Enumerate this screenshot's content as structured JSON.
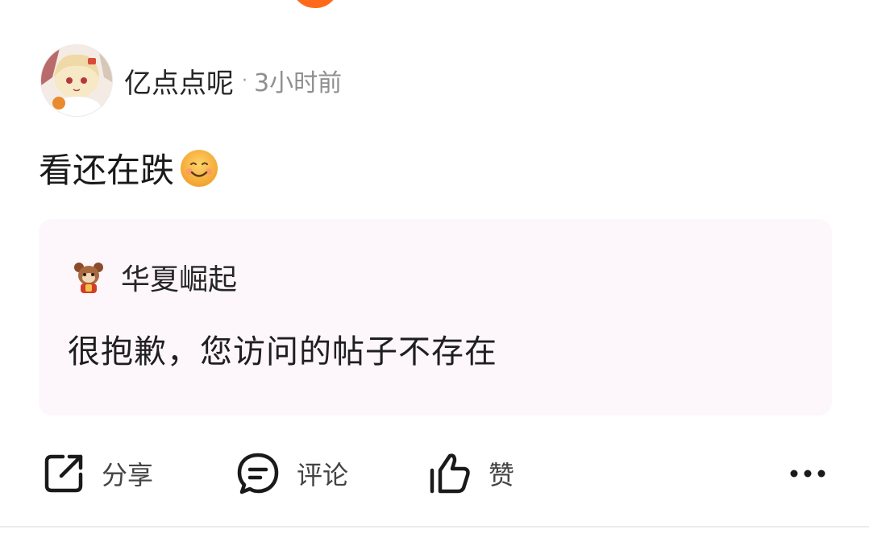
{
  "post": {
    "author": "亿点点呢",
    "separator": "·",
    "time": "3小时前",
    "text": "看还在跌",
    "emoji": "smile-emoji"
  },
  "quote": {
    "author": "华夏崛起",
    "text": "很抱歉，您访问的帖子不存在"
  },
  "actions": {
    "share_label": "分享",
    "comment_label": "评论",
    "like_label": "赞",
    "more_icon": "more-dots-icon"
  },
  "colors": {
    "accent": "#ff6a1a",
    "quote_bg": "#fdf7fb",
    "meta_text": "#8f8f8f"
  }
}
